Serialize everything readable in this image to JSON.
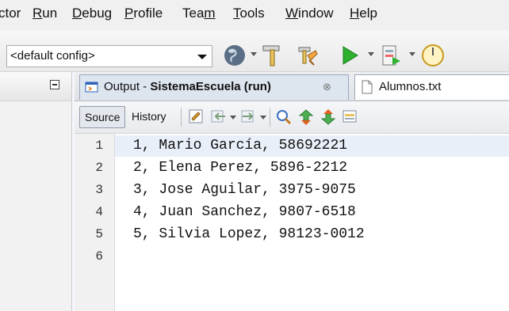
{
  "menubar": {
    "items": [
      {
        "label": "ctor"
      },
      {
        "pre": "",
        "mn": "R",
        "post": "un"
      },
      {
        "pre": "",
        "mn": "D",
        "post": "ebug"
      },
      {
        "pre": "",
        "mn": "P",
        "post": "rofile"
      },
      {
        "pre": "Tea",
        "mn": "m",
        "post": ""
      },
      {
        "pre": "",
        "mn": "T",
        "post": "ools"
      },
      {
        "pre": "",
        "mn": "W",
        "post": "indow"
      },
      {
        "pre": "",
        "mn": "H",
        "post": "elp"
      }
    ]
  },
  "toolbar": {
    "config_value": "<default config>",
    "icons": [
      "globe-icon",
      "hammer-icon",
      "clean-build-icon",
      "run-icon",
      "debug-icon",
      "profile-icon"
    ]
  },
  "tabs": {
    "output": {
      "prefix": "Output - ",
      "project": "SistemaEscuela (run)",
      "close_glyph": "⊗"
    },
    "alumnos": {
      "label": "Alumnos.txt"
    }
  },
  "editor_toolbar": {
    "source_label": "Source",
    "history_label": "History"
  },
  "editor": {
    "line_numbers": [
      "1",
      "2",
      "3",
      "4",
      "5",
      "6"
    ],
    "lines": [
      "1, Mario García, 58692221",
      "2, Elena Perez, 5896-2212",
      "3, Jose Aguilar, 3975-9075",
      "4, Juan Sanchez, 9807-6518",
      "5, Silvia Lopez, 98123-0012",
      ""
    ]
  },
  "colors": {
    "accent": "#3a6fc4",
    "run_green": "#2fb02f",
    "tab_active": "#dde5ef"
  }
}
